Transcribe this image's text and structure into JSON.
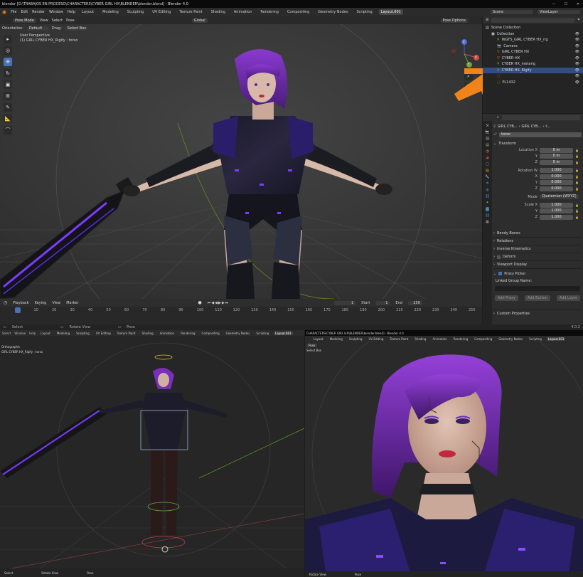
{
  "window": {
    "title": "blender [G:\\TRABAJOS EN PROCESO\\CHARACTERS\\CYBER GIRL HX\\BLENDER\\blender.blend] - Blender 4.0",
    "minimize": "—",
    "maximize": "☐",
    "close": "✕"
  },
  "menus": [
    "File",
    "Edit",
    "Render",
    "Window",
    "Help"
  ],
  "workspace_tabs": [
    "Layout",
    "Modeling",
    "Sculpting",
    "UV Editing",
    "Texture Paint",
    "Shading",
    "Animation",
    "Rendering",
    "Compositing",
    "Geometry Nodes",
    "Scripting",
    "Layout.001"
  ],
  "active_workspace": "Layout.001",
  "scene_label": "Scene",
  "view_layer_label": "ViewLayer",
  "viewport": {
    "mode": "Pose Mode",
    "menus": [
      "View",
      "Select",
      "Pose"
    ],
    "orientation_label": "Orientation:",
    "orientation": "Default",
    "drag_label": "Drag:",
    "drag": "Select Box",
    "transform": "Global",
    "pose_options": "Pose Options",
    "overlay_title": "User Perspective",
    "overlay_sub": "(1) GIRL CYBER HX_Rigify : torso"
  },
  "gizmo": {
    "x": "X",
    "y": "Y",
    "z": "Z"
  },
  "timeline": {
    "menus": [
      "Playback",
      "Keying",
      "View",
      "Marker"
    ],
    "ticks": [
      "1",
      "10",
      "20",
      "30",
      "40",
      "50",
      "60",
      "70",
      "80",
      "90",
      "100",
      "110",
      "120",
      "130",
      "140",
      "150",
      "160",
      "170",
      "180",
      "190",
      "200",
      "210",
      "220",
      "230",
      "240",
      "250"
    ],
    "current_frame": "1",
    "start_label": "Start",
    "start": "1",
    "end_label": "End",
    "end": "250"
  },
  "outliner": {
    "items": [
      {
        "label": "Scene Collection",
        "indent": 0
      },
      {
        "label": "Collection",
        "indent": 1
      },
      {
        "label": "WGTS_GIRL CYBER HX_rig",
        "indent": 2
      },
      {
        "label": "Camera",
        "indent": 2
      },
      {
        "label": "GIRL CYBER HX",
        "indent": 2
      },
      {
        "label": "CYBER HX",
        "indent": 2
      },
      {
        "label": "CYBER HX_metarig",
        "indent": 2
      },
      {
        "label": "CYBER HX_Rigify",
        "indent": 2
      },
      {
        "label": "",
        "indent": 2
      },
      {
        "label": "PL1432",
        "indent": 2
      }
    ]
  },
  "properties": {
    "breadcrumb": [
      "GIRL CYB...",
      "GIRL CYB...",
      "t..."
    ],
    "bone_name": "torso",
    "transform_header": "Transform",
    "location_label": "Location X",
    "location": {
      "x": "0 m",
      "y": "0 m",
      "z": "0 m"
    },
    "rotation_label": "Rotation W",
    "rotation": {
      "w": "1.000",
      "x": "0.000",
      "y": "0.000",
      "z": "0.000"
    },
    "mode_label": "Mode",
    "mode": "Quaternion (WXYZ)",
    "scale_label": "Scale X",
    "scale": {
      "x": "1.000",
      "y": "1.000",
      "z": "1.000"
    },
    "axis": {
      "x": "X",
      "y": "Y",
      "z": "Z",
      "w": "W"
    },
    "panels": [
      "Bendy Bones",
      "Relations",
      "Inverse Kinematics",
      "Deform",
      "Viewport Display"
    ],
    "proxy_picker": "Proxy Picker",
    "linked_group_label": "Linked Group Name:",
    "buttons": [
      "Add Proxy",
      "Add Button",
      "Add Layer"
    ],
    "custom_properties": "Custom Properties"
  },
  "status": {
    "items": [
      "Select",
      "Rotate View",
      "Pose"
    ],
    "version": "4.0.2"
  },
  "bottom_left": {
    "menus": [
      "Select",
      "Window",
      "Help"
    ],
    "overlay_title": "Orthographic",
    "overlay_sub": "GIRL CYBER HX_Rigify : torso",
    "footer": [
      "Select",
      "Rotate View",
      "Pose"
    ]
  },
  "bottom_right": {
    "title": "CHARACTERS\\CYBER GIRL HX\\BLENDER\\blender.blend] - Blender 4.0",
    "mode": "Pose",
    "select_box": "Select Box",
    "footer": [
      "Rotate View",
      "Pose"
    ]
  },
  "colors": {
    "accent": "#4772b3",
    "logo_orange": "#f0841b",
    "logo_blue": "#1f5aa0",
    "suit_purple": "#5b2be0",
    "hair_purple": "#7a2fb8"
  }
}
